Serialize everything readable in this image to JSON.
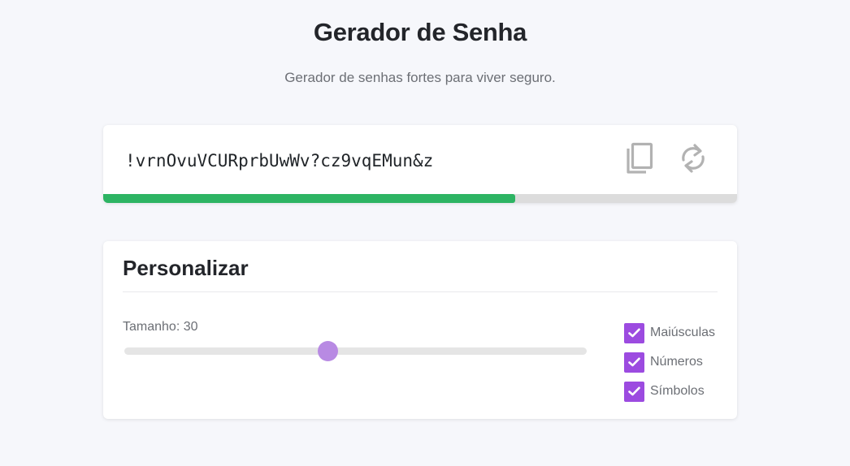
{
  "header": {
    "title": "Gerador de Senha",
    "subtitle": "Gerador de senhas fortes para viver seguro."
  },
  "password": {
    "value": "!vrnOvuVCURprbUwWv?cz9vqEMun&z",
    "strength_fraction": 0.65,
    "strength_color": "#2db463",
    "copy_icon": "copy-icon",
    "refresh_icon": "refresh-icon"
  },
  "customize": {
    "title": "Personalizar",
    "length_label": "Tamanho: 30",
    "slider_fraction": 0.44,
    "slider_color": "#b88ae3",
    "options": [
      {
        "label": "Maiúsculas",
        "checked": true
      },
      {
        "label": "Números",
        "checked": true
      },
      {
        "label": "Símbolos",
        "checked": true
      }
    ],
    "checkbox_color": "#9c4be0"
  }
}
